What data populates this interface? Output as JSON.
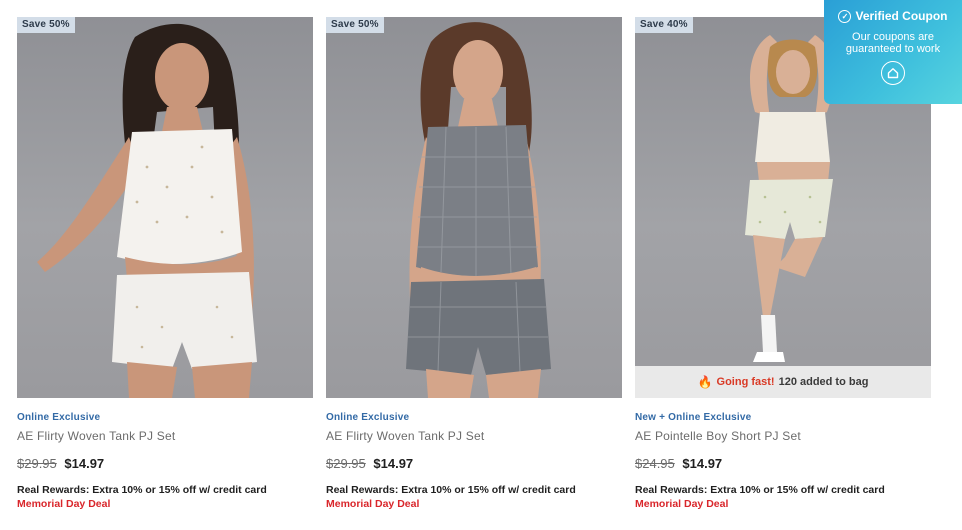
{
  "products": [
    {
      "badge": "Save 50%",
      "tag": "Online Exclusive",
      "name": "AE Flirty Woven Tank PJ Set",
      "old_price": "$29.95",
      "price": "$14.97",
      "rewards": "Real Rewards: Extra 10% or 15% off w/ credit card",
      "deal": "Memorial Day Deal"
    },
    {
      "badge": "Save 50%",
      "tag": "Online Exclusive",
      "name": "AE Flirty Woven Tank PJ Set",
      "old_price": "$29.95",
      "price": "$14.97",
      "rewards": "Real Rewards: Extra 10% or 15% off w/ credit card",
      "deal": "Memorial Day Deal"
    },
    {
      "badge": "Save 40%",
      "tag": "New + Online Exclusive",
      "name": "AE Pointelle Boy Short PJ Set",
      "old_price": "$24.95",
      "price": "$14.97",
      "rewards": "Real Rewards: Extra 10% or 15% off w/ credit card",
      "deal": "Memorial Day Deal",
      "going_fast": {
        "hot": "Going fast!",
        "rest": "120 added to bag",
        "icon": "flame-icon"
      }
    }
  ],
  "coupon": {
    "title": "Verified Coupon",
    "line1": "Our coupons are",
    "line2": "guaranteed to work",
    "icon": "home-icon"
  },
  "colors": {
    "tag_blue": "#336aa6",
    "deal_red": "#d9262b",
    "coupon_blue": "#2a9fd6",
    "badge_bg": "#d3dde8"
  }
}
